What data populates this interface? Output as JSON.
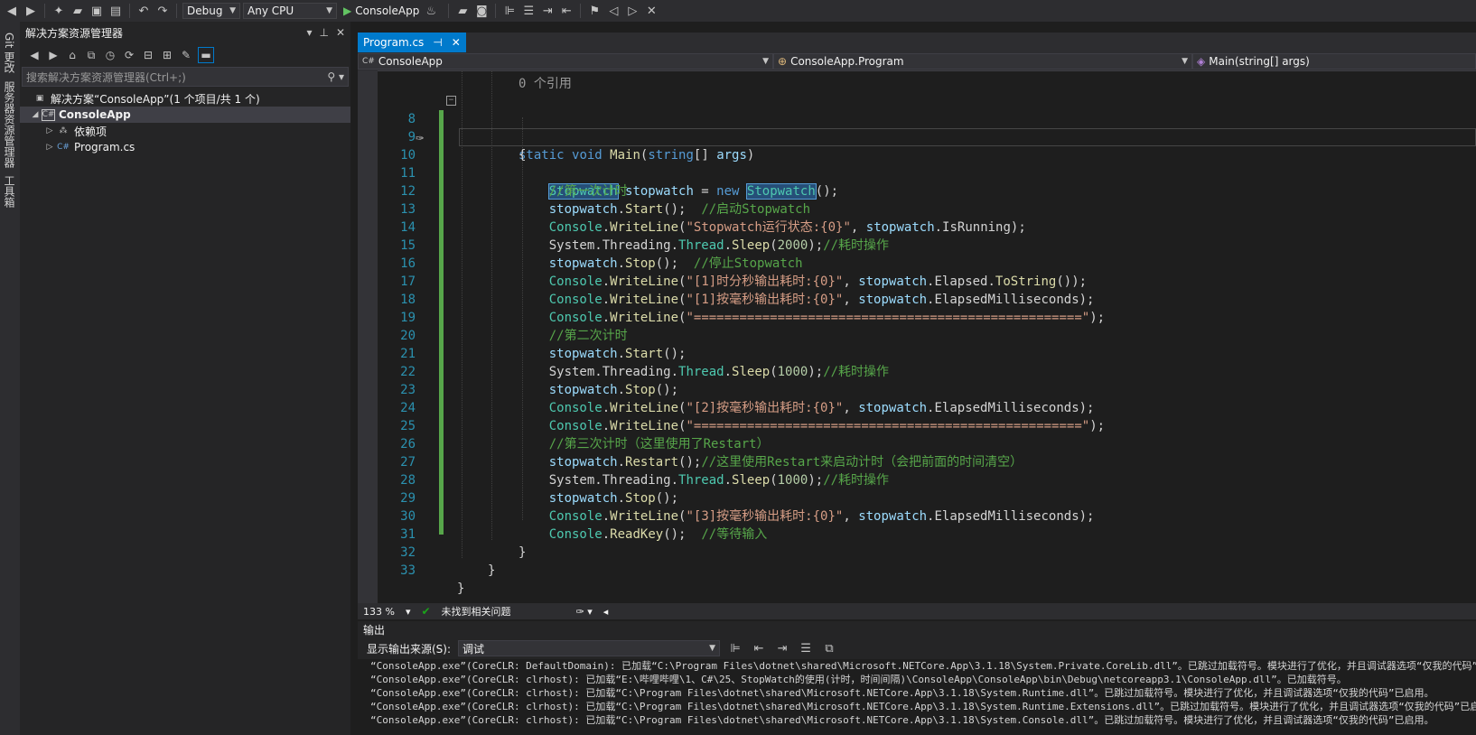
{
  "toolbar": {
    "config": "Debug",
    "platform": "Any CPU",
    "run_label": "ConsoleApp"
  },
  "left_strip": {
    "tabs": [
      "Git 更改",
      "服务器资源管理器",
      "工具箱"
    ]
  },
  "solution_explorer": {
    "title": "解决方案资源管理器",
    "search_placeholder": "搜索解决方案资源管理器(Ctrl+;)",
    "solution": "解决方案“ConsoleApp”(1 个项目/共 1 个)",
    "project": "ConsoleApp",
    "deps": "依赖项",
    "file": "Program.cs"
  },
  "editor": {
    "tab": "Program.cs",
    "nav": {
      "project": "ConsoleApp",
      "class": "ConsoleApp.Program",
      "member": "Main(string[] args)"
    },
    "ref_count": "0 个引用",
    "zoom": "133 %",
    "issues": "未找到相关问题"
  },
  "code_lines": [
    {
      "n": "8",
      "t": "static void Main(string[] args)"
    },
    {
      "n": "9",
      "t": "{"
    },
    {
      "n": "10",
      "t": "    Stopwatch stopwatch = new Stopwatch();"
    },
    {
      "n": "11",
      "t": "    //第一次计时"
    },
    {
      "n": "12",
      "t": "    stopwatch.Start();  //启动Stopwatch"
    },
    {
      "n": "13",
      "t": "    Console.WriteLine(\"Stopwatch运行状态:{0}\", stopwatch.IsRunning);"
    },
    {
      "n": "14",
      "t": "    System.Threading.Thread.Sleep(2000);//耗时操作"
    },
    {
      "n": "15",
      "t": "    stopwatch.Stop();  //停止Stopwatch"
    },
    {
      "n": "16",
      "t": "    Console.WriteLine(\"[1]时分秒输出耗时:{0}\", stopwatch.Elapsed.ToString());"
    },
    {
      "n": "17",
      "t": "    Console.WriteLine(\"[1]按毫秒输出耗时:{0}\", stopwatch.ElapsedMilliseconds);"
    },
    {
      "n": "18",
      "t": "    Console.WriteLine(\"===================================================\");"
    },
    {
      "n": "19",
      "t": "    //第二次计时"
    },
    {
      "n": "20",
      "t": "    stopwatch.Start();"
    },
    {
      "n": "21",
      "t": "    System.Threading.Thread.Sleep(1000);//耗时操作"
    },
    {
      "n": "22",
      "t": "    stopwatch.Stop();"
    },
    {
      "n": "23",
      "t": "    Console.WriteLine(\"[2]按毫秒输出耗时:{0}\", stopwatch.ElapsedMilliseconds);"
    },
    {
      "n": "24",
      "t": "    Console.WriteLine(\"===================================================\");"
    },
    {
      "n": "25",
      "t": "    //第三次计时（这里使用了Restart）"
    },
    {
      "n": "26",
      "t": "    stopwatch.Restart();//这里使用Restart来启动计时（会把前面的时间清空）"
    },
    {
      "n": "27",
      "t": "    System.Threading.Thread.Sleep(1000);//耗时操作"
    },
    {
      "n": "28",
      "t": "    stopwatch.Stop();"
    },
    {
      "n": "29",
      "t": "    Console.WriteLine(\"[3]按毫秒输出耗时:{0}\", stopwatch.ElapsedMilliseconds);"
    },
    {
      "n": "30",
      "t": "    Console.ReadKey();  //等待输入"
    },
    {
      "n": "31",
      "t": "}"
    },
    {
      "n": "32",
      "t": "}"
    },
    {
      "n": "33",
      "t": "}"
    }
  ],
  "output": {
    "title": "输出",
    "source_label": "显示输出来源(S):",
    "source_value": "调试",
    "lines": [
      "“ConsoleApp.exe”(CoreCLR: DefaultDomain): 已加载“C:\\Program Files\\dotnet\\shared\\Microsoft.NETCore.App\\3.1.18\\System.Private.CoreLib.dll”。已跳过加载符号。模块进行了优化，并且调试器选项“仅我的代码”",
      "“ConsoleApp.exe”(CoreCLR: clrhost): 已加载“E:\\哔哩哔哩\\1、C#\\25、StopWatch的使用(计时，时间间隔)\\ConsoleApp\\ConsoleApp\\bin\\Debug\\netcoreapp3.1\\ConsoleApp.dll”。已加载符号。",
      "“ConsoleApp.exe”(CoreCLR: clrhost): 已加载“C:\\Program Files\\dotnet\\shared\\Microsoft.NETCore.App\\3.1.18\\System.Runtime.dll”。已跳过加载符号。模块进行了优化，并且调试器选项“仅我的代码”已启用。",
      "“ConsoleApp.exe”(CoreCLR: clrhost): 已加载“C:\\Program Files\\dotnet\\shared\\Microsoft.NETCore.App\\3.1.18\\System.Runtime.Extensions.dll”。已跳过加载符号。模块进行了优化，并且调试器选项“仅我的代码”已启",
      "“ConsoleApp.exe”(CoreCLR: clrhost): 已加载“C:\\Program Files\\dotnet\\shared\\Microsoft.NETCore.App\\3.1.18\\System.Console.dll”。已跳过加载符号。模块进行了优化，并且调试器选项“仅我的代码”已启用。"
    ]
  }
}
